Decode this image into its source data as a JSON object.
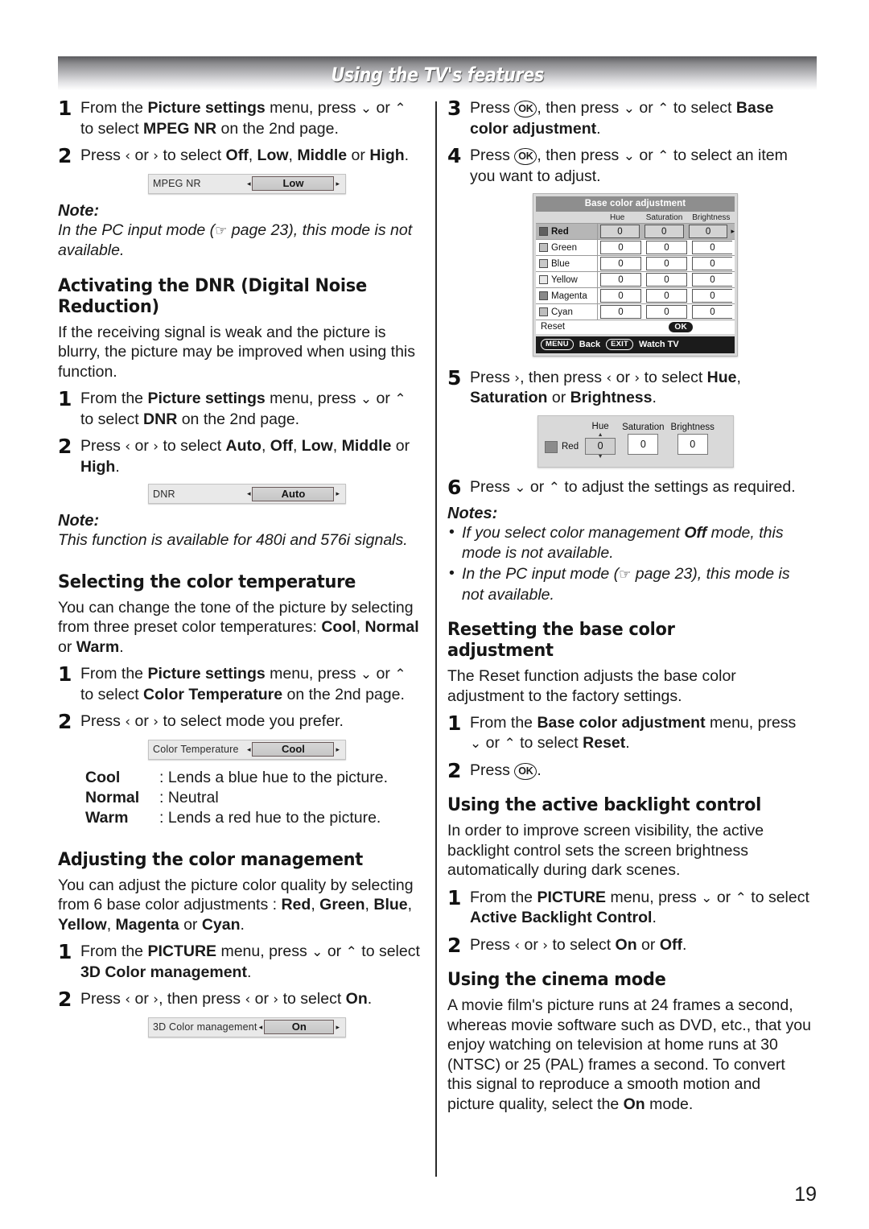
{
  "header": {
    "title": "Using the TV's features"
  },
  "page_number": "19",
  "left_column": {
    "mpeg_nr": {
      "step1": {
        "num": "1",
        "html": "From the <b>Picture settings</b> menu, press <span class=\"ar\">⌄</span> or <span class=\"ar\">⌃</span> to select <b>MPEG NR</b> on the 2nd page."
      },
      "step2": {
        "num": "2",
        "html": "Press <span class=\"ar\">‹</span> or <span class=\"ar\">›</span> to select <b>Off</b>, <b>Low</b>, <b>Middle</b> or <b>High</b>."
      },
      "widget": {
        "label": "MPEG NR",
        "value": "Low",
        "left_arrow": "◂",
        "right_arrow": "▸"
      },
      "note_label": "Note:",
      "note_text_before": "In the PC input mode (",
      "note_hand": "☞",
      "note_text_after": " page 23), this mode is not available."
    },
    "dnr": {
      "heading": "Activating the DNR (Digital Noise Reduction)",
      "intro": "If the receiving signal is weak and the picture is blurry, the picture may be improved when using this function.",
      "step1": {
        "num": "1",
        "html": "From the <b>Picture settings</b> menu, press <span class=\"ar\">⌄</span> or <span class=\"ar\">⌃</span> to select <b>DNR</b> on the 2nd page."
      },
      "step2": {
        "num": "2",
        "html": "Press <span class=\"ar\">‹</span> or <span class=\"ar\">›</span> to select <b>Auto</b>, <b>Off</b>, <b>Low</b>, <b>Middle</b> or <b>High</b>."
      },
      "widget": {
        "label": "DNR",
        "value": "Auto",
        "left_arrow": "◂",
        "right_arrow": "▸"
      },
      "note_label": "Note:",
      "note_text": "This function is available for 480i and 576i signals."
    },
    "color_temperature": {
      "heading": "Selecting the color temperature",
      "intro_html": "You can change the tone of the picture by selecting from three preset color temperatures: <b>Cool</b>, <b>Normal</b> or <b>Warm</b>.",
      "step1": {
        "num": "1",
        "html": "From the <b>Picture settings</b> menu, press <span class=\"ar\">⌄</span> or <span class=\"ar\">⌃</span> to select <b>Color Temperature</b> on the 2nd page."
      },
      "step2": {
        "num": "2",
        "html": "Press <span class=\"ar\">‹</span> or <span class=\"ar\">›</span> to select mode you prefer."
      },
      "widget": {
        "label": "Color Temperature",
        "value": "Cool",
        "left_arrow": "◂",
        "right_arrow": "▸"
      },
      "definitions": [
        {
          "term": "Cool",
          "desc": ": Lends a blue hue to the picture."
        },
        {
          "term": "Normal",
          "desc": ": Neutral"
        },
        {
          "term": "Warm",
          "desc": ": Lends a red hue to the picture."
        }
      ]
    },
    "color_management": {
      "heading": "Adjusting the color management",
      "intro_html": "You can adjust the picture color quality by selecting from 6 base color adjustments : <b>Red</b>, <b>Green</b>, <b>Blue</b>, <b>Yellow</b>, <b>Magenta</b> or <b>Cyan</b>.",
      "step1": {
        "num": "1",
        "html": "From the <b>PICTURE</b> menu, press <span class=\"ar\">⌄</span> or <span class=\"ar\">⌃</span> to select <b>3D Color management</b>."
      },
      "step2": {
        "num": "2",
        "html": "Press <span class=\"ar\">‹</span> or <span class=\"ar\">›</span>, then press <span class=\"ar\">‹</span> or <span class=\"ar\">›</span> to select <b>On</b>."
      },
      "widget": {
        "label": "3D Color management",
        "value": "On",
        "left_arrow": "◂",
        "right_arrow": "▸"
      }
    }
  },
  "right_column": {
    "steps": {
      "step3": {
        "num": "3",
        "html": "Press <span class=\"ok-key\">OK</span>, then press <span class=\"ar\">⌄</span> or <span class=\"ar\">⌃</span> to select <b>Base color adjustment</b>."
      },
      "step4": {
        "num": "4",
        "html": "Press <span class=\"ok-key\">OK</span>, then press <span class=\"ar\">⌄</span> or <span class=\"ar\">⌃</span> to select an item you want to adjust."
      },
      "step5": {
        "num": "5",
        "html": "Press <span class=\"ar\">›</span>, then press <span class=\"ar\">‹</span> or <span class=\"ar\">›</span> to select <b>Hue</b>, <b>Saturation</b> or <b>Brightness</b>."
      },
      "step6": {
        "num": "6",
        "html": "Press <span class=\"ar\">⌄</span> or <span class=\"ar\">⌃</span> to adjust the settings as required."
      }
    },
    "base_color_panel": {
      "title": "Base color adjustment",
      "columns": [
        "Hue",
        "Saturation",
        "Brightness"
      ],
      "rows": [
        {
          "name": "Red",
          "swatch": "#5f5f5f",
          "selected": true,
          "values": [
            "0",
            "0",
            "0"
          ]
        },
        {
          "name": "Green",
          "swatch": "#bfbfbf",
          "selected": false,
          "values": [
            "0",
            "0",
            "0"
          ]
        },
        {
          "name": "Blue",
          "swatch": "#c9c9c9",
          "selected": false,
          "values": [
            "0",
            "0",
            "0"
          ]
        },
        {
          "name": "Yellow",
          "swatch": "#e8e8e8",
          "selected": false,
          "values": [
            "0",
            "0",
            "0"
          ]
        },
        {
          "name": "Magenta",
          "swatch": "#8a8a8a",
          "selected": false,
          "values": [
            "0",
            "0",
            "0"
          ]
        },
        {
          "name": "Cyan",
          "swatch": "#bdbdbd",
          "selected": false,
          "values": [
            "0",
            "0",
            "0"
          ]
        }
      ],
      "reset_label": "Reset",
      "reset_key": "OK",
      "footer": {
        "menu_key": "MENU",
        "menu_label": "Back",
        "exit_key": "EXIT",
        "exit_label": "Watch TV"
      }
    },
    "hsb_panel": {
      "color_name": "Red",
      "fields": [
        {
          "title": "Hue",
          "value": "0",
          "spinner": true
        },
        {
          "title": "Saturation",
          "value": "0",
          "spinner": false
        },
        {
          "title": "Brightness",
          "value": "0",
          "spinner": false
        }
      ]
    },
    "notes": {
      "label": "Notes:",
      "item1_html": "If you select color management <b>Off</b> mode, this mode is not available.",
      "item2_before": "In the PC input mode (",
      "item2_hand": "☞",
      "item2_after": " page 23), this mode is not available."
    },
    "reset_section": {
      "heading": "Resetting the base color adjustment",
      "intro": "The Reset function adjusts the base color adjustment to the factory settings.",
      "step1": {
        "num": "1",
        "html": "From the <b>Base color adjustment</b> menu, press <span class=\"ar\">⌄</span> or <span class=\"ar\">⌃</span> to select <b>Reset</b>."
      },
      "step2": {
        "num": "2",
        "html": "Press <span class=\"ok-key\">OK</span>."
      }
    },
    "backlight_section": {
      "heading": "Using the active backlight control",
      "intro": "In order to improve screen visibility, the active backlight control sets the screen brightness automatically during dark scenes.",
      "step1": {
        "num": "1",
        "html": "From the <b>PICTURE</b> menu, press <span class=\"ar\">⌄</span> or <span class=\"ar\">⌃</span> to select <b>Active Backlight Control</b>."
      },
      "step2": {
        "num": "2",
        "html": "Press <span class=\"ar\">‹</span> or <span class=\"ar\">›</span> to select <b>On</b> or <b>Off</b>."
      }
    },
    "cinema_section": {
      "heading": "Using the cinema mode",
      "intro_html": "A movie film's picture runs at 24 frames a second, whereas movie software such as DVD, etc., that you enjoy watching on television at home runs at 30 (NTSC) or 25 (PAL) frames a second. To convert this signal to reproduce a smooth motion and picture quality, select the <b>On</b> mode."
    }
  }
}
